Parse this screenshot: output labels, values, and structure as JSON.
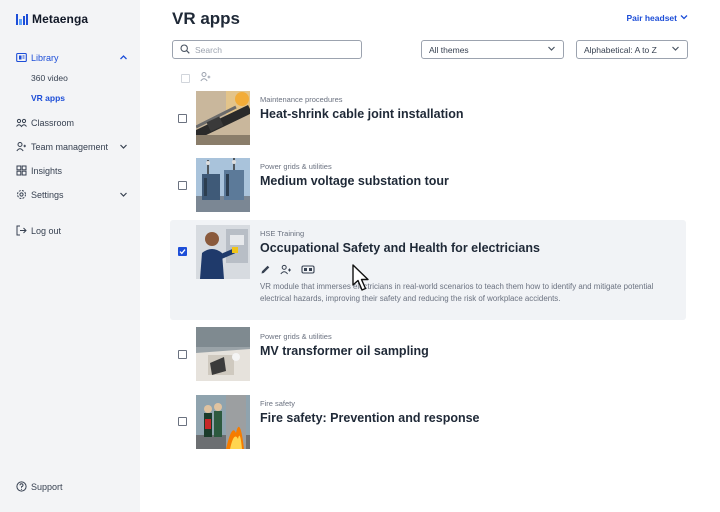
{
  "app": {
    "brand": "Metaenga",
    "brand_color": "#1d4ed8"
  },
  "sidebar": {
    "library": {
      "label": "Library",
      "sub_items": [
        {
          "label": "360 video"
        },
        {
          "label": "VR apps"
        }
      ]
    },
    "classroom": {
      "label": "Classroom"
    },
    "team_management": {
      "label": "Team management"
    },
    "insights": {
      "label": "Insights"
    },
    "settings": {
      "label": "Settings"
    },
    "logout": {
      "label": "Log out"
    },
    "support": {
      "label": "Support"
    }
  },
  "header": {
    "title": "VR apps",
    "pair_headset": "Pair headset"
  },
  "filters": {
    "search_placeholder": "Search",
    "theme_selected": "All themes",
    "sort_selected": "Alphabetical: A to Z"
  },
  "apps": [
    {
      "category": "Maintenance procedures",
      "title": "Heat-shrink cable joint installation",
      "checked": false
    },
    {
      "category": "Power grids & utilities",
      "title": "Medium voltage substation tour",
      "checked": false
    },
    {
      "category": "HSE Training",
      "title": "Occupational Safety and Health for electricians",
      "checked": true,
      "description": "VR module that immerses electricians in real-world scenarios to teach them how to identify and mitigate potential electrical hazards, improving their safety and reducing the risk of workplace accidents."
    },
    {
      "category": "Power grids & utilities",
      "title": "MV transformer oil sampling",
      "checked": false
    },
    {
      "category": "Fire safety",
      "title": "Fire safety: Prevention and response",
      "checked": false
    }
  ],
  "icons": {
    "library": "library-icon",
    "classroom": "classroom-icon",
    "team": "team-icon",
    "insights": "insights-icon",
    "settings": "gear-icon",
    "logout": "logout-icon",
    "support": "help-icon",
    "search": "search-icon",
    "edit": "pencil-icon",
    "assign": "assign-user-icon",
    "headset": "vr-headset-icon"
  }
}
